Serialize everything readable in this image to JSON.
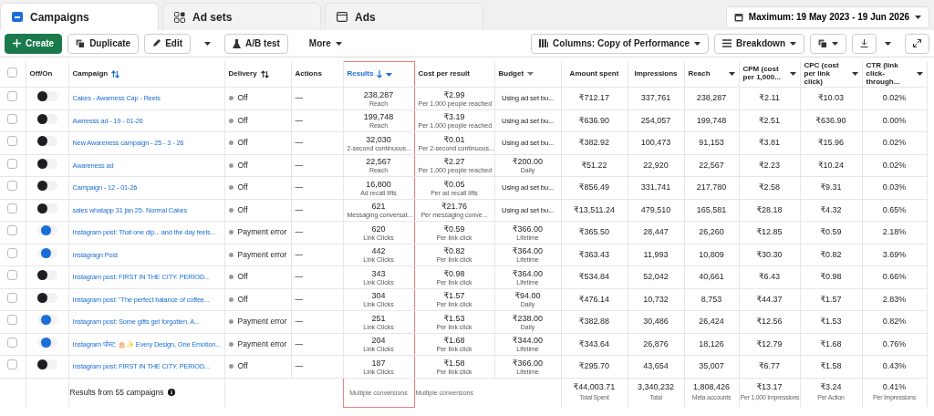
{
  "tabs": [
    {
      "label": "Campaigns",
      "selected": true
    },
    {
      "label": "Ad sets",
      "selected": false
    },
    {
      "label": "Ads",
      "selected": false
    }
  ],
  "date_range": "Maximum: 19 May 2023 - 19 Jun 2026",
  "toolbar": {
    "create": "Create",
    "duplicate": "Duplicate",
    "edit": "Edit",
    "ab_test": "A/B test",
    "more": "More",
    "columns": "Columns: Copy of Performance",
    "breakdown": "Breakdown"
  },
  "table": {
    "select_all_checked": false,
    "columns": [
      {
        "label": "Off/On",
        "selected": false
      },
      {
        "label": "Campaign",
        "selected": false
      },
      {
        "label": "Delivery",
        "selected": false
      },
      {
        "label": "Actions",
        "selected": false
      },
      {
        "label": "Results",
        "selected": true
      },
      {
        "label": "Cost per result",
        "selected": false
      },
      {
        "label": "Budget",
        "selected": false
      },
      {
        "label": "Amount spent",
        "selected": false
      },
      {
        "label": "Impressions",
        "selected": false
      },
      {
        "label": "Reach",
        "selected": false
      },
      {
        "label": "CPM (cost per 1,000...",
        "selected": false
      },
      {
        "label": "CPC (cost per link click)",
        "selected": false
      },
      {
        "label": "CTR (link click-through...",
        "selected": false
      }
    ],
    "rows": [
      {
        "checked": false,
        "on": false,
        "campaign": "Cakes - Awarness Cap - Reels",
        "delivery": "Off",
        "actions": "—",
        "result": "238,287",
        "result_label": "Reach",
        "cost": "₹2.99",
        "cost_label": "Per 1,000 people reached",
        "budget": "Using ad set bu...",
        "amount": "₹712.17",
        "impressions": "337,761",
        "reach": "238,287",
        "cpm": "₹2.11",
        "cpc": "₹10.03",
        "ctr": "0.02%"
      },
      {
        "checked": false,
        "on": false,
        "campaign": "Awrresss ad - 19 - 01-26",
        "delivery": "Off",
        "actions": "—",
        "result": "199,748",
        "result_label": "Reach",
        "cost": "₹3.19",
        "cost_label": "Per 1,000 people reached",
        "budget": "Using ad set bu...",
        "amount": "₹636.90",
        "impressions": "254,057",
        "reach": "199,748",
        "cpm": "₹2.51",
        "cpc": "₹636.90",
        "ctr": "0.00%"
      },
      {
        "checked": false,
        "on": false,
        "campaign": "New Awareness campaign - 25 - 3 - 26",
        "delivery": "Off",
        "actions": "—",
        "result": "32,030",
        "result_label": "2-second continuous...",
        "cost": "₹0.01",
        "cost_label": "Per 2-second continuous...",
        "budget": "Using ad set bu...",
        "amount": "₹382.92",
        "impressions": "100,473",
        "reach": "91,153",
        "cpm": "₹3.81",
        "cpc": "₹15.96",
        "ctr": "0.02%"
      },
      {
        "checked": false,
        "on": false,
        "campaign": "Awareness ad",
        "delivery": "Off",
        "actions": "—",
        "result": "22,567",
        "result_label": "Reach",
        "cost": "₹2.27",
        "cost_label": "Per 1,000 people reached",
        "budget": "₹200.00",
        "budget_label": "Daily",
        "amount": "₹51.22",
        "impressions": "22,920",
        "reach": "22,567",
        "cpm": "₹2.23",
        "cpc": "₹10.24",
        "ctr": "0.02%"
      },
      {
        "checked": false,
        "on": false,
        "campaign": "Campaign - 12 - 01-26",
        "delivery": "Off",
        "actions": "—",
        "result": "16,800",
        "result_label": "Ad recall lifts",
        "cost": "₹0.05",
        "cost_label": "Per ad recall lifts",
        "budget": "Using ad set bu...",
        "amount": "₹856.49",
        "impressions": "331,741",
        "reach": "217,780",
        "cpm": "₹2.58",
        "cpc": "₹9.31",
        "ctr": "0.03%"
      },
      {
        "checked": false,
        "on": false,
        "campaign": "sales whatapp 31 jan 25- Normal Cakes",
        "delivery": "Off",
        "actions": "—",
        "result": "621",
        "result_label": "Messaging conversat...",
        "cost": "₹21.76",
        "cost_label": "Per messaging conve...",
        "budget": "Using ad set bu...",
        "amount": "₹13,511.24",
        "impressions": "479,510",
        "reach": "165,581",
        "cpm": "₹28.18",
        "cpc": "₹4.32",
        "ctr": "0.65%"
      },
      {
        "checked": false,
        "on": true,
        "campaign": "Instagram post: That one dip... and the day feels...",
        "delivery": "Payment error",
        "actions": "—",
        "result": "620",
        "result_label": "Link Clicks",
        "cost": "₹0.59",
        "cost_label": "Per link click",
        "budget": "₹366.00",
        "budget_label": "Lifetime",
        "amount": "₹365.50",
        "impressions": "28,447",
        "reach": "26,260",
        "cpm": "₹12.85",
        "cpc": "₹0.59",
        "ctr": "2.18%"
      },
      {
        "checked": false,
        "on": true,
        "campaign": "Instagragn Post",
        "delivery": "Payment error",
        "actions": "—",
        "result": "442",
        "result_label": "Link Clicks",
        "cost": "₹0.82",
        "cost_label": "Per link click",
        "budget": "₹364.00",
        "budget_label": "Lifetime",
        "amount": "₹363.43",
        "impressions": "11,993",
        "reach": "10,809",
        "cpm": "₹30.30",
        "cpc": "₹0.82",
        "ctr": "3.69%"
      },
      {
        "checked": false,
        "on": false,
        "campaign": "Instagram post: FIRST IN THE CITY. PERIOD...",
        "delivery": "Off",
        "actions": "—",
        "result": "343",
        "result_label": "Link Clicks",
        "cost": "₹0.98",
        "cost_label": "Per link click",
        "budget": "₹364.00",
        "budget_label": "Lifetime",
        "amount": "₹534.84",
        "impressions": "52,042",
        "reach": "40,661",
        "cpm": "₹6.43",
        "cpc": "₹0.98",
        "ctr": "0.66%"
      },
      {
        "checked": false,
        "on": false,
        "campaign": "Instagram post: \"The perfect balance of coffee...",
        "delivery": "Off",
        "actions": "—",
        "result": "304",
        "result_label": "Link Clicks",
        "cost": "₹1.57",
        "cost_label": "Per link click",
        "budget": "₹94.00",
        "budget_label": "Daily",
        "amount": "₹476.14",
        "impressions": "10,732",
        "reach": "8,753",
        "cpm": "₹44.37",
        "cpc": "₹1.57",
        "ctr": "2.83%"
      },
      {
        "checked": false,
        "on": true,
        "campaign": "Instagram post: Some gifts get forgotten. A...",
        "delivery": "Payment error",
        "actions": "—",
        "result": "251",
        "result_label": "Link Clicks",
        "cost": "₹1.53",
        "cost_label": "Per link click",
        "budget": "₹238.00",
        "budget_label": "Daily",
        "amount": "₹382.88",
        "impressions": "30,486",
        "reach": "26,424",
        "cpm": "₹12.56",
        "cpc": "₹1.53",
        "ctr": "0.82%"
      },
      {
        "checked": false,
        "on": true,
        "campaign": "Instagram पोस्ट: 🎂✨ Every Design, One Emotion...",
        "delivery": "Payment error",
        "actions": "—",
        "result": "204",
        "result_label": "Link Clicks",
        "cost": "₹1.68",
        "cost_label": "Per link click",
        "budget": "₹344.00",
        "budget_label": "Lifetime",
        "amount": "₹343.64",
        "impressions": "26,876",
        "reach": "18,126",
        "cpm": "₹12.79",
        "cpc": "₹1.68",
        "ctr": "0.76%"
      },
      {
        "checked": false,
        "on": false,
        "campaign": "Instagram post: FIRST IN THE CITY. PERIOD...",
        "delivery": "Off",
        "actions": "—",
        "result": "187",
        "result_label": "Link Clicks",
        "cost": "₹1.58",
        "cost_label": "Per link click",
        "budget": "₹366.00",
        "budget_label": "Lifetime",
        "amount": "₹295.70",
        "impressions": "43,654",
        "reach": "35,007",
        "cpm": "₹6.77",
        "cpc": "₹1.58",
        "ctr": "0.43%"
      }
    ],
    "footer": {
      "summary": "Results from 55 campaigns",
      "result": "Multiple conversions",
      "cost": "Multiple conversions",
      "totals": [
        {
          "value": "₹44,003.71",
          "label": "Total Spent"
        },
        {
          "value": "3,340,232",
          "label": "Total"
        },
        {
          "value": "1,808,426",
          "label": "Meta accounts"
        },
        {
          "value": "₹13.17",
          "label": "Per 1,000 Impressions"
        },
        {
          "value": "₹3.24",
          "label": "Per Action"
        },
        {
          "value": "0.41%",
          "label": "Per Impressions"
        }
      ]
    }
  }
}
